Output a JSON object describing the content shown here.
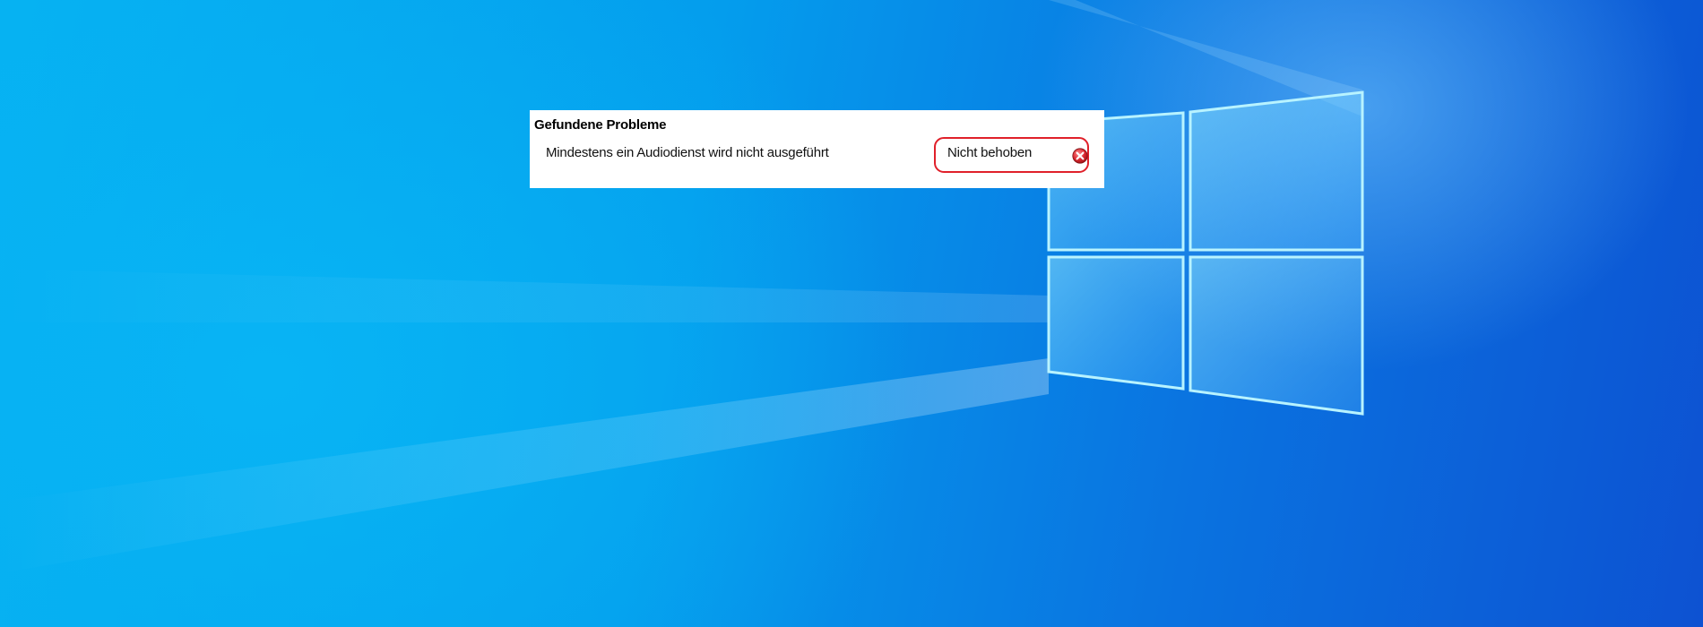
{
  "panel": {
    "heading": "Gefundene Probleme",
    "problems": [
      {
        "description": "Mindestens ein Audiodienst wird nicht ausgeführt",
        "status": "Nicht behoben",
        "status_icon": "error-x-icon"
      }
    ]
  },
  "colors": {
    "highlight_border": "#e0202a",
    "error_icon_red": "#d8262e",
    "panel_background": "#ffffff",
    "desktop_blue": "#049ded"
  }
}
